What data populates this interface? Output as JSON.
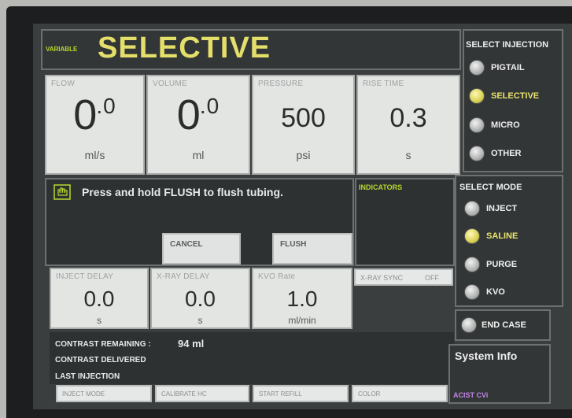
{
  "header": {
    "variable_label": "VARIABLE",
    "mode_title": "SELECTIVE"
  },
  "params_top": [
    {
      "label": "FLOW",
      "value": "0",
      "decimal": ".0",
      "unit": "ml/s"
    },
    {
      "label": "VOLUME",
      "value": "0",
      "decimal": ".0",
      "unit": "ml"
    },
    {
      "label": "PRESSURE",
      "value": "500",
      "unit": "psi"
    },
    {
      "label": "RISE TIME",
      "value": "0.3",
      "unit": "s"
    }
  ],
  "message": {
    "icon": "hand-press-icon",
    "text": "Press and hold FLUSH to flush tubing.",
    "cancel_label": "CANCEL",
    "flush_label": "FLUSH"
  },
  "indicators": {
    "label": "INDICATORS"
  },
  "params_bottom": [
    {
      "label": "INJECT DELAY",
      "value": "0.0",
      "unit": "s"
    },
    {
      "label": "X-RAY DELAY",
      "value": "0.0",
      "unit": "s"
    },
    {
      "label": "KVO Rate",
      "value": "1.0",
      "unit": "ml/min"
    }
  ],
  "xray_sync": {
    "label": "X-RAY SYNC",
    "state": "OFF"
  },
  "info": {
    "contrast_remaining_label": "CONTRAST REMAINING :",
    "contrast_remaining_value": "94 ml",
    "contrast_delivered_label": "CONTRAST DELIVERED",
    "last_injection_label": "LAST INJECTION"
  },
  "bottom_tabs": [
    "INJECT MODE",
    "CALIBRATE HC",
    "START REFILL",
    "COLOR"
  ],
  "select_injection": {
    "header": "SELECT INJECTION",
    "options": [
      {
        "label": "PIGTAIL",
        "selected": false
      },
      {
        "label": "SELECTIVE",
        "selected": true
      },
      {
        "label": "MICRO",
        "selected": false
      },
      {
        "label": "OTHER",
        "selected": false
      }
    ]
  },
  "select_mode": {
    "header": "SELECT MODE",
    "options": [
      {
        "label": "INJECT",
        "selected": false
      },
      {
        "label": "SALINE",
        "selected": true
      },
      {
        "label": "PURGE",
        "selected": false
      },
      {
        "label": "KVO",
        "selected": false
      }
    ]
  },
  "end_case_label": "END CASE",
  "system_info_label": "System Info",
  "brand_label": "ACIST CVi",
  "colors": {
    "accent_yellow": "#e4df6a",
    "indicator_green": "#b6d930",
    "brand_purple": "#c184e8"
  }
}
